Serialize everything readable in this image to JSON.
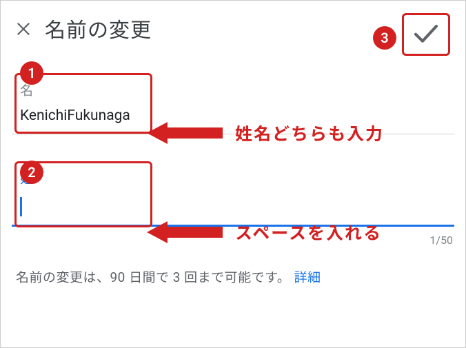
{
  "header": {
    "title": "名前の変更"
  },
  "fields": {
    "firstName": {
      "label": "名",
      "value": "KenichiFukunaga"
    },
    "lastName": {
      "label": "姓",
      "value": " "
    }
  },
  "counter": "1/50",
  "notice": {
    "text": "名前の変更は、90 日間で 3 回まで可能です。",
    "link": "詳細"
  },
  "annotations": {
    "badge1": "1",
    "badge2": "2",
    "badge3": "3",
    "note1": "姓名どちらも入力",
    "note2": "スペースを入れる"
  },
  "colors": {
    "annotation": "#d32020",
    "primary": "#1a73e8"
  }
}
